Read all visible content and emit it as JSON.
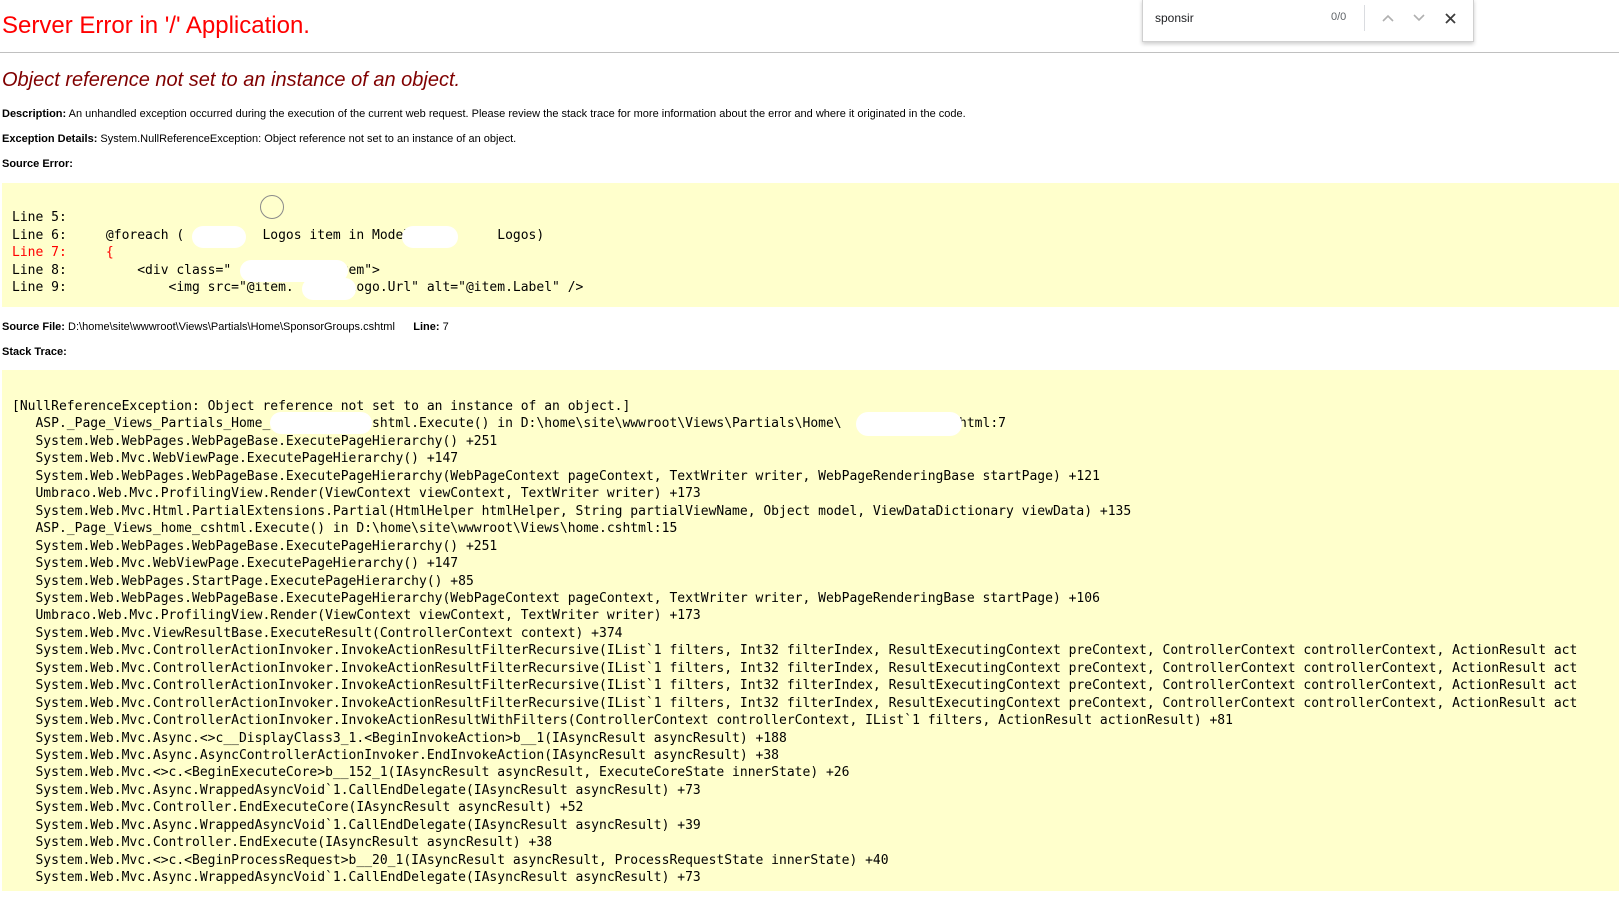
{
  "page": {
    "title": "Server Error in '/' Application.",
    "error_message": "Object reference not set to an instance of an object.",
    "description_label": "Description:",
    "description_text": "An unhandled exception occurred during the execution of the current web request. Please review the stack trace for more information about the error and where it originated in the code.",
    "exception_label": "Exception Details:",
    "exception_text": "System.NullReferenceException: Object reference not set to an instance of an object.",
    "source_error_label": "Source Error:",
    "source_file_label": "Source File:",
    "source_file_path": "D:\\home\\site\\wwwroot\\Views\\Partials\\Home\\SponsorGroups.cshtml",
    "line_label": "Line:",
    "line_number": "7",
    "stack_trace_label": "Stack Trace:"
  },
  "source_error": {
    "lines": [
      "Line 5:",
      "Line 6:     @foreach (          Logos item in Model.          Logos)",
      "Line 7:     {",
      "Line 8:         <div class=\"             item\">",
      "Line 9:             <img src=\"@item.       Logo.Url\" alt=\"@item.Label\" />"
    ],
    "highlighted_line_index": 2
  },
  "stack_trace": {
    "lines": [
      "[NullReferenceException: Object reference not set to an instance of an object.]",
      "   ASP._Page_Views_Partials_Home_           _cshtml.Execute() in D:\\home\\site\\wwwroot\\Views\\Partials\\Home\\             cshtml:7",
      "   System.Web.WebPages.WebPageBase.ExecutePageHierarchy() +251",
      "   System.Web.Mvc.WebViewPage.ExecutePageHierarchy() +147",
      "   System.Web.WebPages.WebPageBase.ExecutePageHierarchy(WebPageContext pageContext, TextWriter writer, WebPageRenderingBase startPage) +121",
      "   Umbraco.Web.Mvc.ProfilingView.Render(ViewContext viewContext, TextWriter writer) +173",
      "   System.Web.Mvc.Html.PartialExtensions.Partial(HtmlHelper htmlHelper, String partialViewName, Object model, ViewDataDictionary viewData) +135",
      "   ASP._Page_Views_home_cshtml.Execute() in D:\\home\\site\\wwwroot\\Views\\home.cshtml:15",
      "   System.Web.WebPages.WebPageBase.ExecutePageHierarchy() +251",
      "   System.Web.Mvc.WebViewPage.ExecutePageHierarchy() +147",
      "   System.Web.WebPages.StartPage.ExecutePageHierarchy() +85",
      "   System.Web.WebPages.WebPageBase.ExecutePageHierarchy(WebPageContext pageContext, TextWriter writer, WebPageRenderingBase startPage) +106",
      "   Umbraco.Web.Mvc.ProfilingView.Render(ViewContext viewContext, TextWriter writer) +173",
      "   System.Web.Mvc.ViewResultBase.ExecuteResult(ControllerContext context) +374",
      "   System.Web.Mvc.ControllerActionInvoker.InvokeActionResultFilterRecursive(IList`1 filters, Int32 filterIndex, ResultExecutingContext preContext, ControllerContext controllerContext, ActionResult act",
      "   System.Web.Mvc.ControllerActionInvoker.InvokeActionResultFilterRecursive(IList`1 filters, Int32 filterIndex, ResultExecutingContext preContext, ControllerContext controllerContext, ActionResult act",
      "   System.Web.Mvc.ControllerActionInvoker.InvokeActionResultFilterRecursive(IList`1 filters, Int32 filterIndex, ResultExecutingContext preContext, ControllerContext controllerContext, ActionResult act",
      "   System.Web.Mvc.ControllerActionInvoker.InvokeActionResultFilterRecursive(IList`1 filters, Int32 filterIndex, ResultExecutingContext preContext, ControllerContext controllerContext, ActionResult act",
      "   System.Web.Mvc.ControllerActionInvoker.InvokeActionResultWithFilters(ControllerContext controllerContext, IList`1 filters, ActionResult actionResult) +81",
      "   System.Web.Mvc.Async.<>c__DisplayClass3_1.<BeginInvokeAction>b__1(IAsyncResult asyncResult) +188",
      "   System.Web.Mvc.Async.AsyncControllerActionInvoker.EndInvokeAction(IAsyncResult asyncResult) +38",
      "   System.Web.Mvc.<>c.<BeginExecuteCore>b__152_1(IAsyncResult asyncResult, ExecuteCoreState innerState) +26",
      "   System.Web.Mvc.Async.WrappedAsyncVoid`1.CallEndDelegate(IAsyncResult asyncResult) +73",
      "   System.Web.Mvc.Controller.EndExecuteCore(IAsyncResult asyncResult) +52",
      "   System.Web.Mvc.Async.WrappedAsyncVoid`1.CallEndDelegate(IAsyncResult asyncResult) +39",
      "   System.Web.Mvc.Controller.EndExecute(IAsyncResult asyncResult) +38",
      "   System.Web.Mvc.<>c.<BeginProcessRequest>b__20_1(IAsyncResult asyncResult, ProcessRequestState innerState) +40",
      "   System.Web.Mvc.Async.WrappedAsyncVoid`1.CallEndDelegate(IAsyncResult asyncResult) +73"
    ]
  },
  "find_bar": {
    "query": "sponsir",
    "match_count": "0/0",
    "icons": [
      "chevron-up-icon",
      "chevron-down-icon",
      "close-icon"
    ]
  },
  "colors": {
    "title": "#ff0000",
    "error_message": "#800000",
    "code_background": "#ffffcc",
    "highlight_line": "#ff0000"
  }
}
